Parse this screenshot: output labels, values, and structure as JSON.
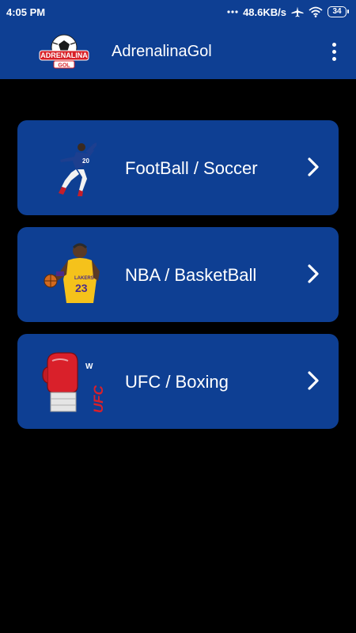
{
  "status_bar": {
    "time": "4:05 PM",
    "network_speed": "48.6KB/s",
    "battery": "34",
    "icons": [
      "signal-dots-icon",
      "airplane-mode-icon",
      "wifi-icon",
      "battery-icon"
    ]
  },
  "app_bar": {
    "title": "AdrenalinaGol",
    "logo_text_top": "ADRENALINA",
    "logo_text_bottom": "GOL",
    "menu_icon": "more-vert-icon"
  },
  "categories": [
    {
      "label": "FootBall / Soccer",
      "icon": "soccer-player-icon",
      "chevron": "chevron-right-icon"
    },
    {
      "label": "NBA / BasketBall",
      "icon": "basketball-player-icon",
      "chevron": "chevron-right-icon"
    },
    {
      "label": "UFC / Boxing",
      "icon": "boxing-glove-ufc-icon",
      "chevron": "chevron-right-icon",
      "badge_text": "UFC"
    }
  ],
  "colors": {
    "primary": "#0e3f93",
    "background": "#000000",
    "text": "#ffffff"
  }
}
